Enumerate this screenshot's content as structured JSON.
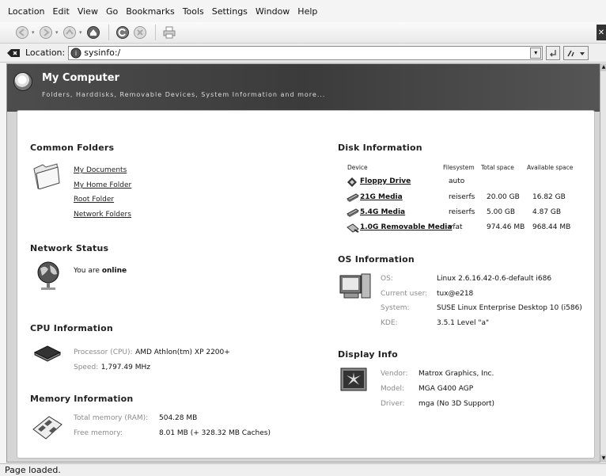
{
  "menu": [
    {
      "label": "Location"
    },
    {
      "label": "Edit"
    },
    {
      "label": "View"
    },
    {
      "label": "Go"
    },
    {
      "label": "Bookmarks"
    },
    {
      "label": "Tools"
    },
    {
      "label": "Settings"
    },
    {
      "label": "Window"
    },
    {
      "label": "Help"
    }
  ],
  "location": {
    "label": "Location:",
    "url": "sysinfo:/"
  },
  "header": {
    "title": "My Computer",
    "subtitle": "Folders, Harddisks, Removable Devices, System Information and more..."
  },
  "common_folders": {
    "title": "Common Folders",
    "items": [
      "My Documents",
      "My Home Folder",
      "Root Folder",
      "Network Folders"
    ]
  },
  "network_status": {
    "title": "Network Status",
    "prefix": "You are",
    "state": "online"
  },
  "cpu": {
    "title": "CPU Information",
    "processor_label": "Processor (CPU):",
    "processor_value": "AMD Athlon(tm) XP 2200+",
    "speed_label": "Speed:",
    "speed_value": "1,797.49 MHz"
  },
  "memory": {
    "title": "Memory Information",
    "total_label": "Total memory (RAM):",
    "total_value": "504.28 MB",
    "free_label": "Free memory:",
    "free_value": "8.01 MB (+ 328.32 MB Caches)"
  },
  "disk": {
    "title": "Disk Information",
    "columns": [
      "Device",
      "Filesystem",
      "Total space",
      "Available space"
    ],
    "rows": [
      {
        "name": "Floppy Drive",
        "fs": "auto",
        "total": "",
        "avail": ""
      },
      {
        "name": "21G Media",
        "fs": "reiserfs",
        "total": "20.00 GB",
        "avail": "16.82 GB"
      },
      {
        "name": "5.4G Media",
        "fs": "reiserfs",
        "total": "5.00 GB",
        "avail": "4.87 GB"
      },
      {
        "name": "1.0G Removable Media",
        "fs": "vfat",
        "total": "974.46 MB",
        "avail": "968.44 MB"
      }
    ]
  },
  "os": {
    "title": "OS Information",
    "os_label": "OS:",
    "os_value": "Linux 2.6.16.42-0.6-default i686",
    "user_label": "Current user:",
    "user_value": "tux@e218",
    "system_label": "System:",
    "system_value": "SUSE Linux Enterprise Desktop 10 (i586)",
    "kde_label": "KDE:",
    "kde_value": "3.5.1 Level \"a\""
  },
  "display": {
    "title": "Display Info",
    "vendor_label": "Vendor:",
    "vendor_value": "Matrox Graphics, Inc.",
    "model_label": "Model:",
    "model_value": "MGA G400 AGP",
    "driver_label": "Driver:",
    "driver_value": "mga (No 3D Support)"
  },
  "status": "Page loaded."
}
